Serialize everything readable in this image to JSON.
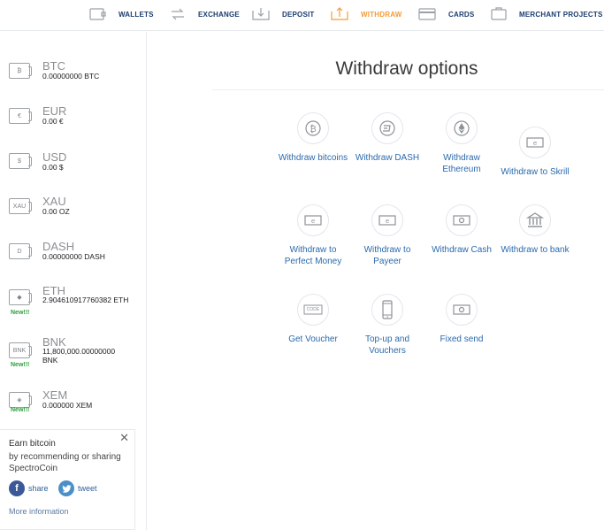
{
  "topnav": {
    "items": [
      {
        "label": "WALLETS",
        "icon": "wallet-icon"
      },
      {
        "label": "EXCHANGE",
        "icon": "exchange-icon"
      },
      {
        "label": "DEPOSIT",
        "icon": "deposit-icon"
      },
      {
        "label": "WITHDRAW",
        "icon": "withdraw-icon",
        "active": true
      },
      {
        "label": "CARDS",
        "icon": "card-icon"
      },
      {
        "label": "MERCHANT PROJECTS",
        "icon": "briefcase-icon"
      }
    ],
    "colors": {
      "default": "#1b3b6f",
      "active": "#f29c38"
    }
  },
  "sidebar": {
    "wallets": [
      {
        "code": "BTC",
        "balance": "0.00000000 BTC",
        "icon_symbol": "₿"
      },
      {
        "code": "EUR",
        "balance": "0.00 €",
        "icon_symbol": "€"
      },
      {
        "code": "USD",
        "balance": "0.00 $",
        "icon_symbol": "$"
      },
      {
        "code": "XAU",
        "balance": "0.00 OZ",
        "icon_symbol": "XAU"
      },
      {
        "code": "DASH",
        "balance": "0.00000000 DASH",
        "icon_symbol": "D"
      },
      {
        "code": "ETH",
        "balance": "2.904610917760382 ETH",
        "icon_symbol": "◆",
        "badge": "New!!!"
      },
      {
        "code": "BNK",
        "balance": "11,800,000.00000000 BNK",
        "icon_symbol": "BNK",
        "badge": "New!!!"
      },
      {
        "code": "XEM",
        "balance": "0.000000 XEM",
        "icon_symbol": "◈",
        "badge": "New!!!"
      }
    ]
  },
  "promo": {
    "title": "Earn bitcoin",
    "text": "by recommending or sharing SpectroCoin",
    "share_label": "share",
    "tweet_label": "tweet",
    "more_info": "More information"
  },
  "main": {
    "title": "Withdraw options",
    "options": [
      {
        "label": "Withdraw bitcoins",
        "icon": "bitcoin-icon"
      },
      {
        "label": "Withdraw DASH",
        "icon": "dash-icon"
      },
      {
        "label": "Withdraw Ethereum",
        "icon": "ethereum-icon"
      },
      {
        "label": "Withdraw to Skrill",
        "icon": "ewallet-icon"
      },
      {
        "label": "Withdraw to Perfect Money",
        "icon": "ewallet-icon"
      },
      {
        "label": "Withdraw to Payeer",
        "icon": "ewallet-icon"
      },
      {
        "label": "Withdraw Cash",
        "icon": "cash-icon"
      },
      {
        "label": "Withdraw to bank",
        "icon": "bank-icon"
      },
      {
        "label": "Get Voucher",
        "icon": "voucher-code-icon",
        "icon_text": "CODE"
      },
      {
        "label": "Top-up and Vouchers",
        "icon": "mobile-phone-icon"
      },
      {
        "label": "Fixed send",
        "icon": "cash-icon"
      }
    ]
  }
}
